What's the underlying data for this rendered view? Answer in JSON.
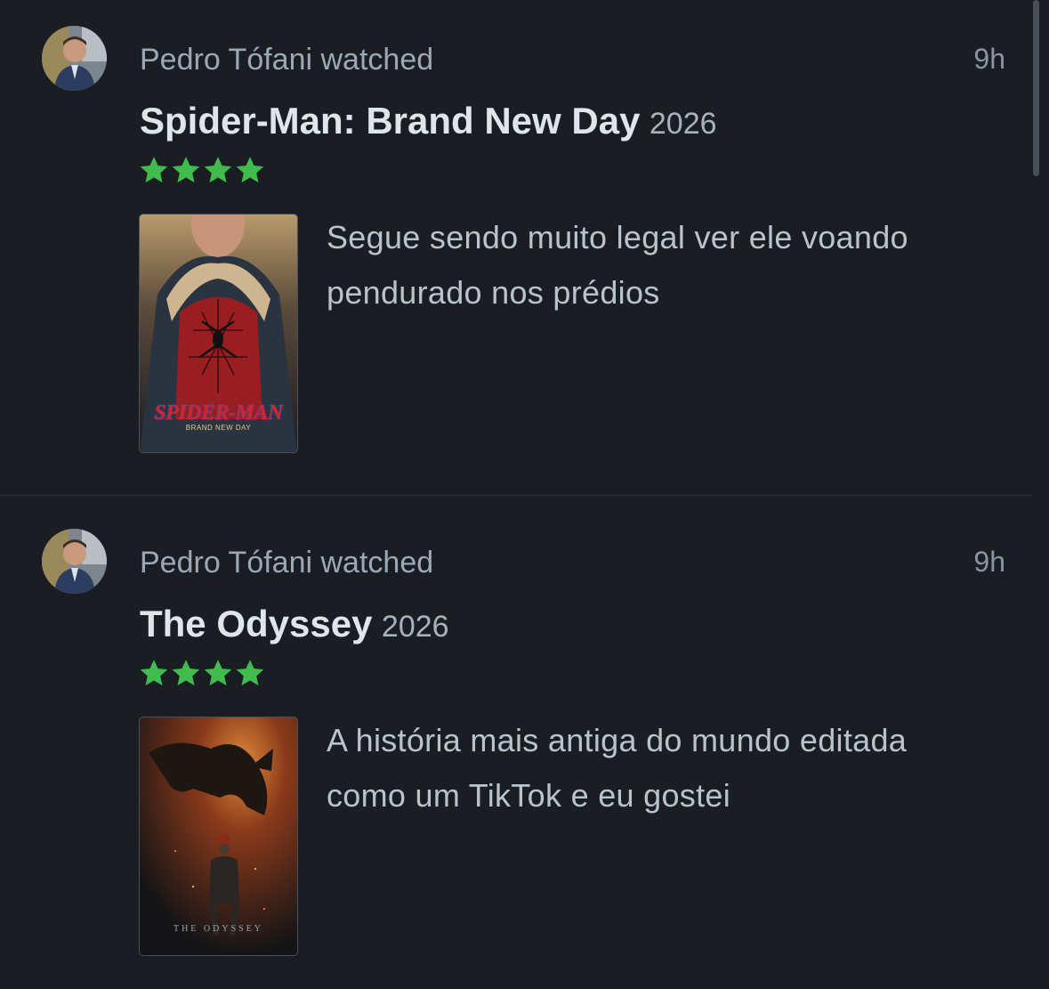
{
  "feed": {
    "entries": [
      {
        "activity": "Pedro Tófani watched",
        "time": "9h",
        "film_title": "Spider-Man: Brand New Day",
        "year": "2026",
        "rating_stars": 4,
        "review": "Segue sendo muito legal ver ele voando pendurado nos prédios",
        "poster_text": "SPIDER-MAN",
        "poster_subtext": "BRAND NEW DAY"
      },
      {
        "activity": "Pedro Tófani watched",
        "time": "9h",
        "film_title": "The Odyssey",
        "year": "2026",
        "rating_stars": 4,
        "review": "A história mais antiga do mundo editada como um TikTok e eu gostei",
        "poster_text": "THE ODYSSEY"
      }
    ]
  },
  "colors": {
    "background": "#1a1d22",
    "star": "#40bc4f",
    "divider": "#2f353c"
  }
}
